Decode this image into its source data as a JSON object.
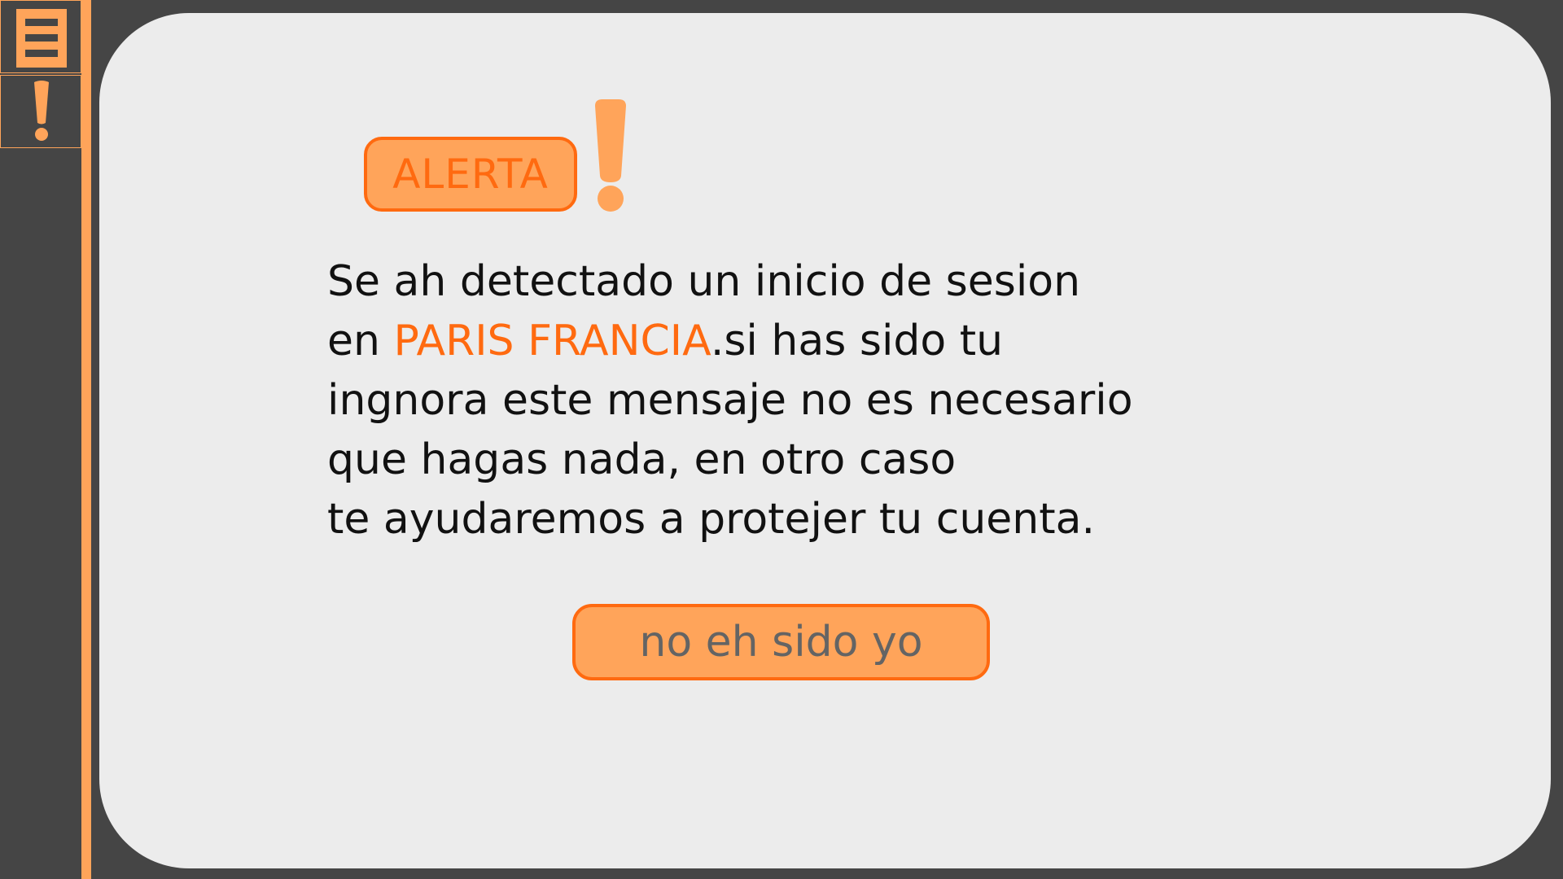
{
  "sidebar": {
    "items": [
      {
        "icon": "hamburger-menu-icon"
      },
      {
        "icon": "exclamation-icon"
      }
    ]
  },
  "alert": {
    "badge_label": "ALERTA",
    "badge_icon": "exclamation-icon",
    "message": {
      "line1": "Se ah detectado un inicio de sesion",
      "line2_prefix": "en ",
      "line2_location": "PARIS FRANCIA",
      "line2_suffix": ".si has sido tu",
      "line3": "ingnora este mensaje no es necesario",
      "line4": "que hagas nada, en otro caso",
      "line5": "te ayudaremos a protejer tu cuenta."
    },
    "action_label": "no eh sido yo"
  },
  "colors": {
    "accent": "#ff6a10",
    "accent_light": "#ffa45a",
    "background": "#454545",
    "card": "#ececec",
    "text": "#111111",
    "button_text": "#646464"
  }
}
